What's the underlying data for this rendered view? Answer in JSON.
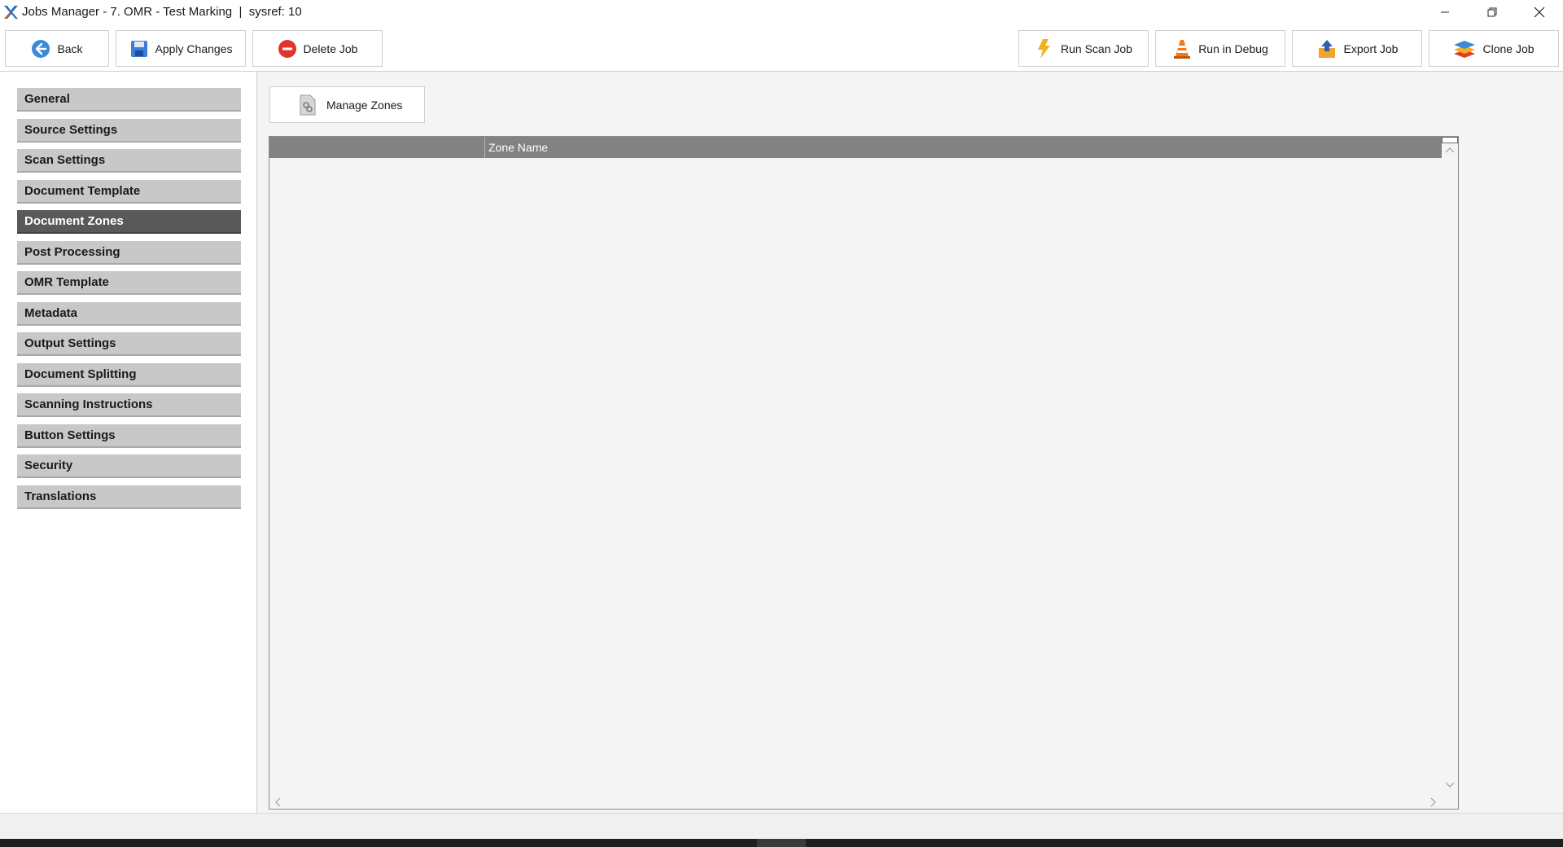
{
  "window": {
    "title": "Jobs Manager - 7. OMR - Test Marking  |  sysref: 10",
    "controls": [
      "minimize-icon",
      "restore-icon",
      "close-icon"
    ]
  },
  "toolbar": {
    "back_label": "Back",
    "apply_label": "Apply Changes",
    "delete_label": "Delete Job",
    "run_scan_label": "Run Scan Job",
    "run_debug_label": "Run in Debug",
    "export_label": "Export Job",
    "clone_label": "Clone Job"
  },
  "sidebar": {
    "items": [
      {
        "label": "General"
      },
      {
        "label": "Source Settings"
      },
      {
        "label": "Scan Settings"
      },
      {
        "label": "Document Template"
      },
      {
        "label": "Document Zones",
        "active": true
      },
      {
        "label": "Post Processing"
      },
      {
        "label": "OMR Template"
      },
      {
        "label": "Metadata"
      },
      {
        "label": "Output Settings"
      },
      {
        "label": "Document Splitting"
      },
      {
        "label": "Scanning Instructions"
      },
      {
        "label": "Button Settings"
      },
      {
        "label": "Security"
      },
      {
        "label": "Translations"
      }
    ]
  },
  "main": {
    "manage_zones_label": "Manage Zones",
    "grid": {
      "columns": [
        "Zone Name"
      ],
      "rows": []
    }
  },
  "colors": {
    "nav_item": "#c8c8c8",
    "nav_active": "#595959",
    "grid_header": "#828282",
    "panel_bg": "#f4f4f4"
  }
}
